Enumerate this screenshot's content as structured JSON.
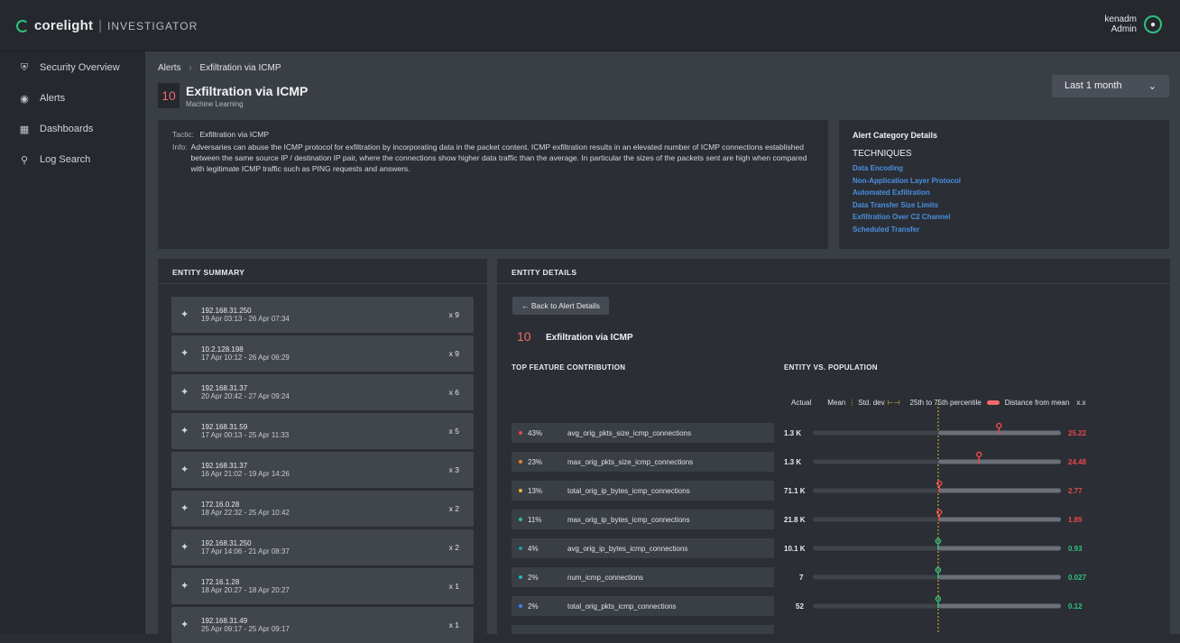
{
  "app": {
    "brand": "corelight",
    "product": "INVESTIGATOR"
  },
  "user": {
    "name": "kenadm",
    "role": "Admin"
  },
  "sidebar": {
    "items": [
      {
        "label": "Security Overview",
        "icon": "shield-icon"
      },
      {
        "label": "Alerts",
        "icon": "radar-icon"
      },
      {
        "label": "Dashboards",
        "icon": "grid-icon"
      },
      {
        "label": "Log Search",
        "icon": "search-icon"
      }
    ]
  },
  "breadcrumb": {
    "root": "Alerts",
    "current": "Exfiltration via ICMP"
  },
  "alert": {
    "score": "10",
    "title": "Exfiltration via ICMP",
    "subtitle": "Machine Learning"
  },
  "date_range": {
    "selected": "Last 1 month"
  },
  "info": {
    "tactic_label": "Tactic:",
    "tactic": "Exfiltration via ICMP",
    "info_label": "Info:",
    "info_text": "Adversaries can abuse the ICMP protocol for exfiltration by incorporating data in the packet content. ICMP exfiltration results in an elevated number of ICMP connections established between the same source IP / destination IP pair, where the connections show higher data traffic than the average. In particular the sizes of the packets sent are high when compared with legitimate ICMP traffic such as PING requests and answers."
  },
  "category": {
    "title": "Alert Category Details",
    "techniques_label": "TECHNIQUES",
    "techniques": [
      "Data Encoding",
      "Non-Application Layer Protocol",
      "Automated Exfiltration",
      "Data Transfer Size Limits",
      "Exfiltration Over C2 Channel",
      "Scheduled Transfer"
    ]
  },
  "entity_summary": {
    "header": "ENTITY SUMMARY",
    "entities": [
      {
        "ip": "192.168.31.250",
        "range": "19 Apr 03:13 - 26 Apr 07:34",
        "count": "x 9"
      },
      {
        "ip": "10.2.128.198",
        "range": "17 Apr 10:12 - 26 Apr 06:29",
        "count": "x 9"
      },
      {
        "ip": "192.168.31.37",
        "range": "20 Apr 20:42 - 27 Apr 09:24",
        "count": "x 6"
      },
      {
        "ip": "192.168.31.59",
        "range": "17 Apr 00:13 - 25 Apr 11:33",
        "count": "x 5"
      },
      {
        "ip": "192.168.31.37",
        "range": "16 Apr 21:02 - 19 Apr 14:26",
        "count": "x 3"
      },
      {
        "ip": "172.16.0.28",
        "range": "18 Apr 22:32 - 25 Apr 10:42",
        "count": "x 2"
      },
      {
        "ip": "192.168.31.250",
        "range": "17 Apr 14:06 - 21 Apr 08:37",
        "count": "x 2"
      },
      {
        "ip": "172.16.1.28",
        "range": "18 Apr 20:27 - 18 Apr 20:27",
        "count": "x 1"
      },
      {
        "ip": "192.168.31.49",
        "range": "25 Apr 09:17 - 25 Apr 09:17",
        "count": "x 1"
      }
    ]
  },
  "entity_details": {
    "header": "ENTITY DETAILS",
    "back_label": "← Back to Alert Details",
    "score": "10",
    "title": "Exfiltration via ICMP",
    "top_feature_label": "TOP FEATURE CONTRIBUTION",
    "evp_label": "ENTITY VS. POPULATION",
    "legend": {
      "actual": "Actual",
      "mean": "Mean",
      "std": "Std. dev",
      "percentile": "25th to 75th percentile",
      "distance": "Distance from mean",
      "distance_unit": "x.x"
    },
    "colors": {
      "red": "#e5484d",
      "green": "#2ec27e",
      "mean": "#e5b53a"
    },
    "features": [
      {
        "pct": "43%",
        "name": "avg_orig_pkts_size_icmp_connections",
        "actual": "1.3 K",
        "distance": "25.22",
        "dot": "#e5484d",
        "marker_pos": 0.75,
        "side": "above"
      },
      {
        "pct": "23%",
        "name": "max_orig_pkts_size_icmp_connections",
        "actual": "1.3 K",
        "distance": "24.48",
        "dot": "#f07c2e",
        "marker_pos": 0.67,
        "side": "above"
      },
      {
        "pct": "13%",
        "name": "total_orig_ip_bytes_icmp_connections",
        "actual": "71.1 K",
        "distance": "2.77",
        "dot": "#e5b53a",
        "marker_pos": 0.51,
        "side": "above"
      },
      {
        "pct": "11%",
        "name": "max_orig_ip_bytes_icmp_connections",
        "actual": "21.8 K",
        "distance": "1.89",
        "dot": "#2ec27e",
        "marker_pos": 0.51,
        "side": "above"
      },
      {
        "pct": "4%",
        "name": "avg_orig_ip_bytes_icmp_connections",
        "actual": "10.1 K",
        "distance": "0.93",
        "dot": "#19a39a",
        "marker_pos": 0.505,
        "side": "above"
      },
      {
        "pct": "2%",
        "name": "num_icmp_connections",
        "actual": "7",
        "distance": "0.027",
        "dot": "#22b8cf",
        "marker_pos": 0.505,
        "side": "above"
      },
      {
        "pct": "2%",
        "name": "total_orig_pkts_icmp_connections",
        "actual": "52",
        "distance": "0.12",
        "dot": "#3b82f6",
        "marker_pos": 0.505,
        "side": "above"
      }
    ]
  }
}
